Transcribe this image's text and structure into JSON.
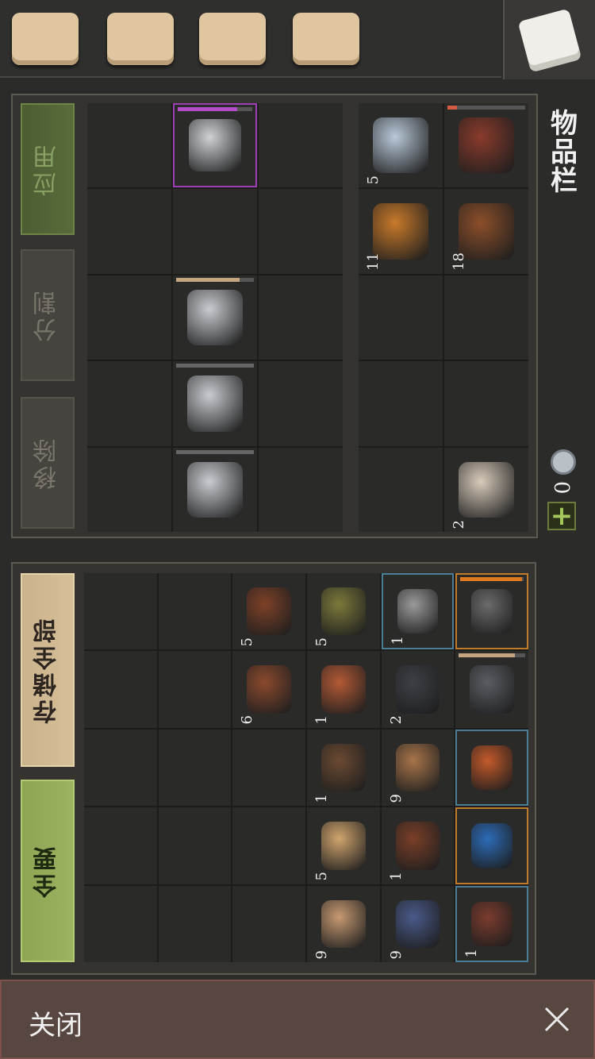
{
  "tabs": [
    {
      "name": "character-tab",
      "icon": "backpack-icon"
    },
    {
      "name": "journal-tab",
      "icon": "scroll-feather-icon"
    },
    {
      "name": "map-tab",
      "icon": "map-icon"
    },
    {
      "name": "skills-tab",
      "icon": "sun-book-icon"
    },
    {
      "name": "inventory-tab",
      "icon": "chest-icon",
      "active": true
    }
  ],
  "inventory": {
    "title": "物品栏",
    "currency_amount": "0",
    "add_label": "+",
    "buttons": {
      "use": "应用",
      "split": "分割",
      "remove": "移除"
    },
    "grid": [
      [
        {
          "icon": "lantern-icon",
          "count": "5"
        },
        {
          "icon": "round-shield-icon",
          "bar": 0.12,
          "barColor": "#d45a44"
        }
      ],
      [
        {
          "icon": "stew-bowl-icon",
          "count": "11"
        },
        {
          "icon": "barrel-icon",
          "count": "18"
        }
      ],
      [
        {},
        {}
      ],
      [
        {},
        {}
      ],
      [
        {},
        {
          "icon": "cloth-roll-icon",
          "count": "2"
        }
      ]
    ],
    "equip": [
      {
        "icon": "sickle-icon",
        "bar": 0.8,
        "barColor": "#b24cc9",
        "selected": true
      },
      {},
      {
        "icon": "sword-icon",
        "bar": 0.82,
        "barColor": "#c4a481"
      },
      {
        "icon": "sword-icon",
        "bar": 1,
        "barColor": "#666"
      },
      {
        "icon": "sword-icon",
        "bar": 1,
        "barColor": "#666"
      }
    ]
  },
  "storage": {
    "buttons": {
      "store_all": "存储全部",
      "take_all": "全要"
    },
    "items": [
      [
        {
          "icon": "wooden-mug-icon",
          "count": "5"
        },
        {
          "icon": "herb-ball-icon",
          "count": "5"
        },
        {
          "icon": "iron-clamp-icon",
          "count": "1",
          "frame": "blue"
        },
        {
          "icon": "pickaxe-icon",
          "bar": 0.98,
          "barColor": "#e0781e",
          "frame": "orange"
        }
      ],
      [
        {
          "icon": "leather-scroll-icon",
          "count": "6"
        },
        {
          "icon": "hourglass-icon",
          "count": "1"
        },
        {
          "icon": "gear-icon",
          "count": "2"
        },
        {
          "icon": "halberd-icon",
          "bar": 0.85,
          "barColor": "#c4a481"
        }
      ],
      [
        {},
        {
          "icon": "bear-trap-icon",
          "count": "1"
        },
        {
          "icon": "grain-sack-icon",
          "count": "9"
        },
        {
          "icon": "sun-book-icon",
          "frame": "blue"
        }
      ],
      [
        {},
        {
          "icon": "candle-icon",
          "count": "5"
        },
        {
          "icon": "sausage-icon",
          "count": "1"
        },
        {
          "icon": "mask-book-icon",
          "frame": "orange"
        }
      ],
      [
        {},
        {
          "icon": "leather-hide-icon",
          "count": "9"
        },
        {
          "icon": "crystal-shard-icon",
          "count": "9"
        },
        {
          "icon": "leather-collar-icon",
          "count": "1",
          "frame": "blue"
        }
      ]
    ]
  },
  "footer": {
    "close_label": "关闭",
    "close_icon": "close-icon"
  },
  "colors": {
    "bg": "#2b2b2a",
    "panel_border": "#5d5a52",
    "accent_green": "#9bb35f",
    "close_bar": "#584640"
  }
}
